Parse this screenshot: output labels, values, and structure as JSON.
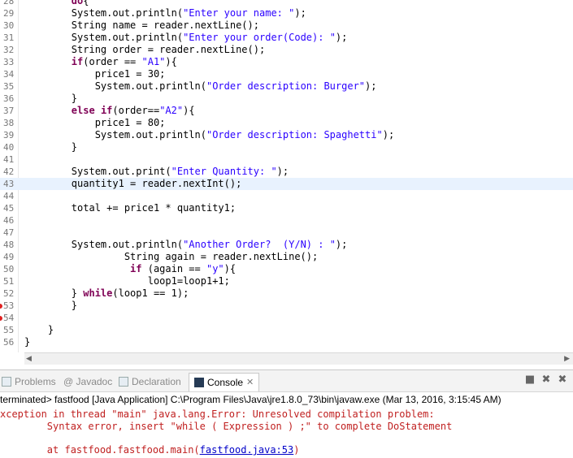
{
  "editor": {
    "lines": [
      {
        "num": "28",
        "code": "        do{"
      },
      {
        "num": "29",
        "code": "        System.out.println(\"Enter your name: \");"
      },
      {
        "num": "30",
        "code": "        String name = reader.nextLine();"
      },
      {
        "num": "31",
        "code": "        System.out.println(\"Enter your order(Code): \");"
      },
      {
        "num": "32",
        "code": "        String order = reader.nextLine();"
      },
      {
        "num": "33",
        "code": "        if(order == \"A1\"){"
      },
      {
        "num": "34",
        "code": "            price1 = 30;"
      },
      {
        "num": "35",
        "code": "            System.out.println(\"Order description: Burger\");"
      },
      {
        "num": "36",
        "code": "        }"
      },
      {
        "num": "37",
        "code": "        else if(order==\"A2\"){"
      },
      {
        "num": "38",
        "code": "            price1 = 80;"
      },
      {
        "num": "39",
        "code": "            System.out.println(\"Order description: Spaghetti\");"
      },
      {
        "num": "40",
        "code": "        }"
      },
      {
        "num": "41",
        "code": ""
      },
      {
        "num": "42",
        "code": "        System.out.print(\"Enter Quantity: \");"
      },
      {
        "num": "43",
        "code": "        quantity1 = reader.nextInt();"
      },
      {
        "num": "44",
        "code": ""
      },
      {
        "num": "45",
        "code": "        total += price1 * quantity1;"
      },
      {
        "num": "46",
        "code": ""
      },
      {
        "num": "47",
        "code": ""
      },
      {
        "num": "48",
        "code": "        System.out.println(\"Another Order?  (Y/N) : \");"
      },
      {
        "num": "49",
        "code": "                 String again = reader.nextLine();"
      },
      {
        "num": "50",
        "code": "                  if (again == \"y\"){"
      },
      {
        "num": "51",
        "code": "                     loop1=loop1+1;"
      },
      {
        "num": "52",
        "code": "        } while(loop1 == 1);"
      },
      {
        "num": "53",
        "code": "        }"
      },
      {
        "num": "54",
        "code": ""
      },
      {
        "num": "55",
        "code": "    }"
      },
      {
        "num": "56",
        "code": "}"
      }
    ],
    "current_line": "43",
    "error_lines": [
      "53",
      "54"
    ]
  },
  "tabs": [
    {
      "label": "Problems",
      "active": false
    },
    {
      "label": "@ Javadoc",
      "active": false
    },
    {
      "label": "Declaration",
      "active": false
    },
    {
      "label": "Console",
      "active": true
    }
  ],
  "console": {
    "status": "terminated> fastfood [Java Application] C:\\Program Files\\Java\\jre1.8.0_73\\bin\\javaw.exe (Mar 13, 2016, 3:15:45 AM)",
    "error_line1": "xception in thread \"main\" java.lang.Error: Unresolved compilation problem:",
    "error_line2": "        Syntax error, insert \"while ( Expression ) ;\" to complete DoStatement",
    "stack_prefix": "        at fastfood.fastfood.main(",
    "stack_link": "fastfood.java:53",
    "stack_suffix": ")"
  }
}
